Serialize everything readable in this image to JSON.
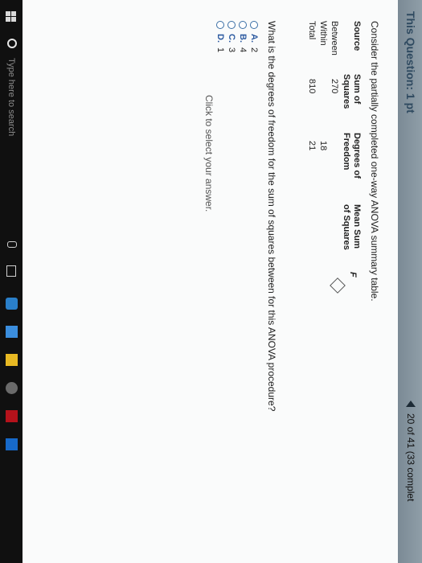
{
  "header": {
    "question_title": "This Question: 1 pt",
    "progress": "20 of 41 (33 complet"
  },
  "main": {
    "prompt": "Consider the partially completed one-way ANOVA summary table.",
    "table": {
      "headers": {
        "source": "Source",
        "ss_line1": "Sum of",
        "ss_line2": "Squares",
        "df_line1": "Degrees of",
        "df_line2": "Freedom",
        "ms_line1": "Mean Sum",
        "ms_line2": "of Squares",
        "f": "F"
      },
      "rows": [
        {
          "source": "Between",
          "ss": "270",
          "df": ""
        },
        {
          "source": "Within",
          "ss": "",
          "df": "18"
        },
        {
          "source": "Total",
          "ss": "810",
          "df": "21"
        }
      ]
    },
    "question": "What is the degrees of freedom for the sum of squares between for this ANOVA procedure?",
    "options": [
      {
        "letter": "A.",
        "value": "2"
      },
      {
        "letter": "B.",
        "value": "4"
      },
      {
        "letter": "C.",
        "value": "3"
      },
      {
        "letter": "D.",
        "value": "1"
      }
    ],
    "hint": "Click to select your answer."
  },
  "taskbar": {
    "search_placeholder": "Type here to search"
  }
}
